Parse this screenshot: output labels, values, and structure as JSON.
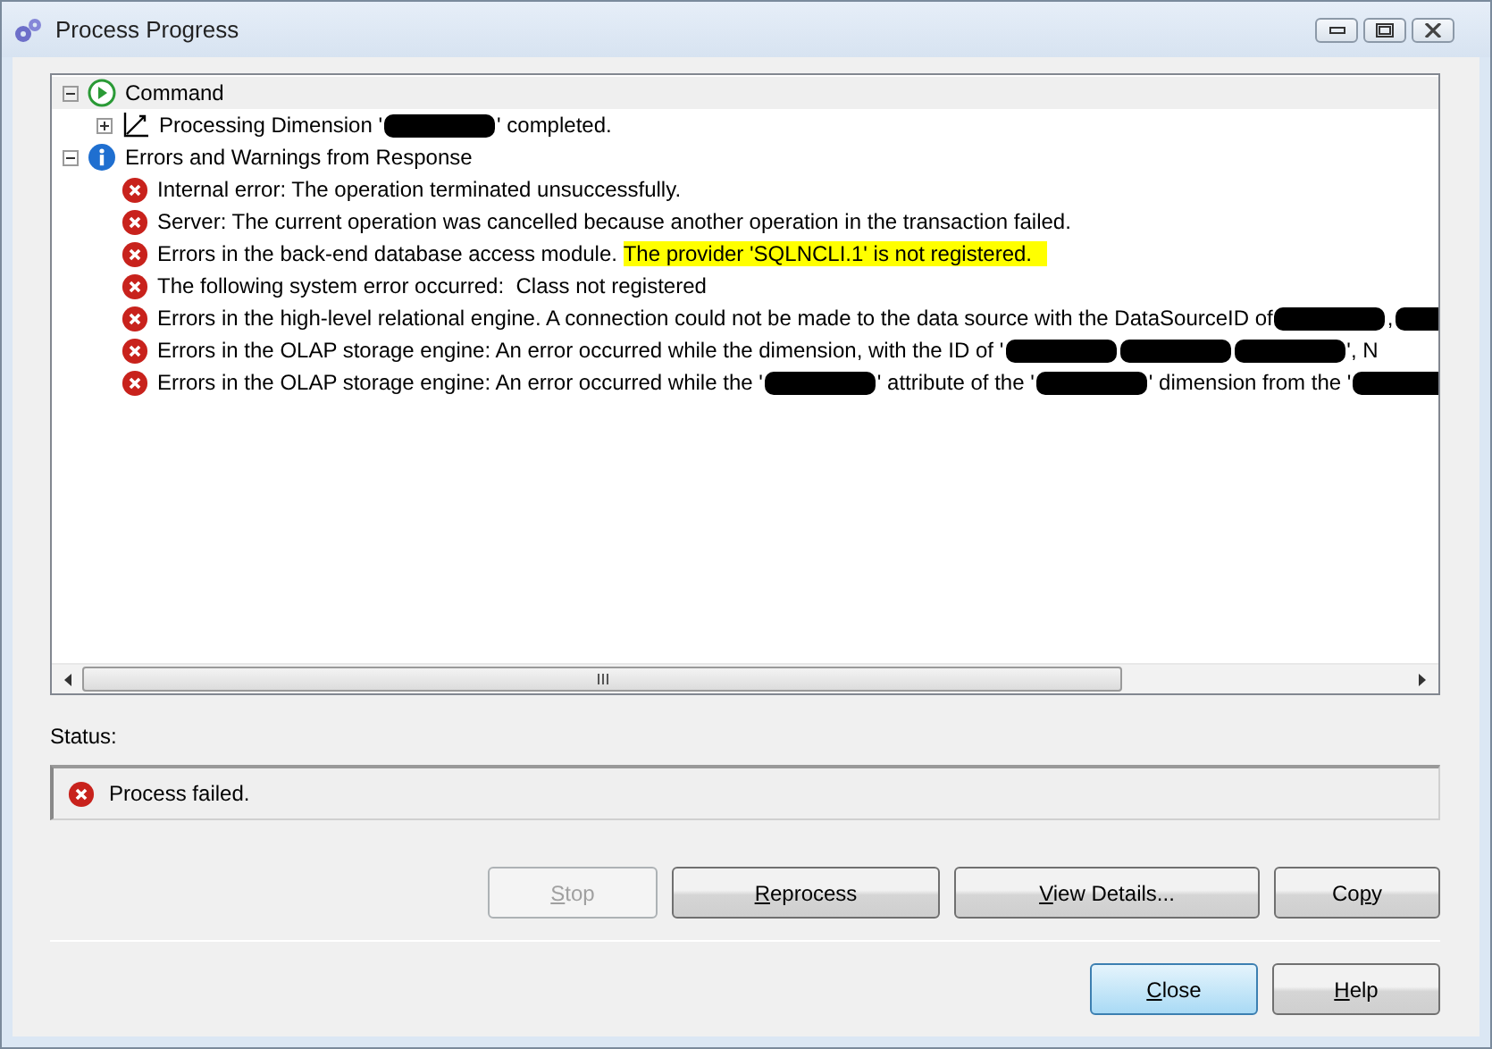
{
  "window": {
    "title": "Process Progress"
  },
  "tree": [
    {
      "kind": "command",
      "label": [
        {
          "kind": "text",
          "text": "Command"
        }
      ],
      "expanded": true,
      "selected": true,
      "children": [
        {
          "kind": "dimension",
          "label": [
            {
              "kind": "text",
              "text": "Processing Dimension '"
            },
            {
              "kind": "redaction"
            },
            {
              "kind": "text",
              "text": "' completed."
            }
          ],
          "expanded": false,
          "selected": false
        }
      ]
    },
    {
      "kind": "info",
      "label": [
        {
          "kind": "text",
          "text": "Errors and Warnings from Response"
        }
      ],
      "expanded": true,
      "selected": false,
      "children": [
        {
          "kind": "error",
          "label": [
            {
              "kind": "text",
              "text": "Internal error: The operation terminated unsuccessfully."
            }
          ],
          "selected": false
        },
        {
          "kind": "error",
          "label": [
            {
              "kind": "text",
              "text": "Server: The current operation was cancelled because another operation in the transaction failed."
            }
          ],
          "selected": false
        },
        {
          "kind": "error",
          "label": [
            {
              "kind": "text",
              "text": "Errors in the back-end database access module. "
            },
            {
              "kind": "highlight",
              "text": "The provider 'SQLNCLI.1' is not registered."
            }
          ],
          "selected": false
        },
        {
          "kind": "error",
          "label": [
            {
              "kind": "text",
              "text": "The following system error occurred:  Class not registered"
            }
          ],
          "selected": false
        },
        {
          "kind": "error",
          "label": [
            {
              "kind": "text",
              "text": "Errors in the high-level relational engine. A connection could not be made to the data source with the DataSourceID of"
            },
            {
              "kind": "redaction"
            },
            {
              "kind": "text",
              "text": ","
            },
            {
              "kind": "redaction"
            }
          ],
          "selected": false
        },
        {
          "kind": "error",
          "label": [
            {
              "kind": "text",
              "text": "Errors in the OLAP storage engine: An error occurred while the dimension, with the ID of '"
            },
            {
              "kind": "redaction"
            },
            {
              "kind": "redaction"
            },
            {
              "kind": "redaction"
            },
            {
              "kind": "text",
              "text": "', N"
            }
          ],
          "selected": false
        },
        {
          "kind": "error",
          "label": [
            {
              "kind": "text",
              "text": "Errors in the OLAP storage engine: An error occurred while the '"
            },
            {
              "kind": "redaction"
            },
            {
              "kind": "text",
              "text": "' attribute of the '"
            },
            {
              "kind": "redaction"
            },
            {
              "kind": "text",
              "text": "' dimension from the '"
            },
            {
              "kind": "redaction"
            }
          ],
          "selected": false
        }
      ]
    }
  ],
  "status": {
    "label": "Status:",
    "kind": "error",
    "text": "Process failed."
  },
  "action_buttons": [
    {
      "label": {
        "key": "S",
        "after": "top"
      },
      "disabled": true
    },
    {
      "label": {
        "key": "R",
        "after": "eprocess"
      },
      "disabled": false
    },
    {
      "label": {
        "key": "V",
        "after": "iew Details..."
      },
      "disabled": false
    },
    {
      "label": {
        "before": "Co",
        "key": "p",
        "after": "y"
      },
      "disabled": false
    }
  ],
  "dialog_buttons": [
    {
      "label": {
        "key": "C",
        "after": "lose"
      },
      "default": true
    },
    {
      "label": {
        "key": "H",
        "after": "elp"
      },
      "default": false
    }
  ]
}
